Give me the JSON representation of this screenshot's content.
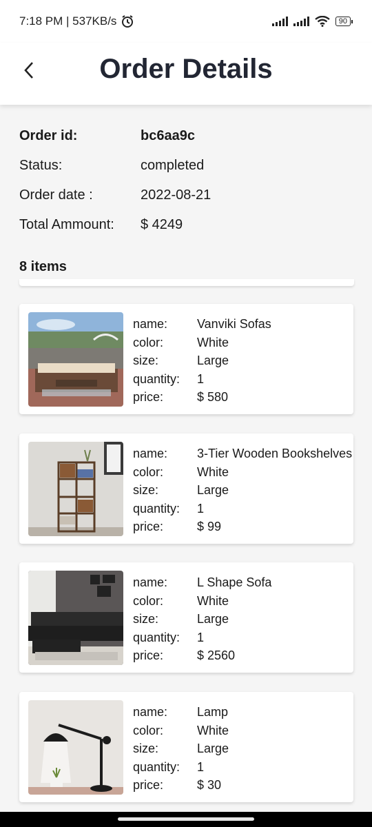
{
  "status_bar": {
    "time": "7:18 PM | 537KB/s",
    "battery": "90"
  },
  "app_bar": {
    "title": "Order Details"
  },
  "order": {
    "id_label": "Order id:",
    "id_value": "bc6aa9c",
    "status_label": "Status:",
    "status_value": "completed",
    "date_label": "Order date :",
    "date_value": "2022-08-21",
    "total_label": "Total Ammount:",
    "total_value": "$ 4249"
  },
  "items_count": "8 items",
  "field_labels": {
    "name": "name:",
    "color": "color:",
    "size": "size:",
    "quantity": "quantity:",
    "price": "price:"
  },
  "items": [
    {
      "name": "Vanviki Sofas",
      "color": "White",
      "size": "Large",
      "quantity": "1",
      "price": "$ 580",
      "image": "outdoor-sofa-set-photo"
    },
    {
      "name": "3-Tier Wooden Bookshelves",
      "color": "White",
      "size": "Large",
      "quantity": "1",
      "price": "$ 99",
      "image": "bookshelf-photo"
    },
    {
      "name": "L Shape Sofa",
      "color": "White",
      "size": "Large",
      "quantity": "1",
      "price": "$ 2560",
      "image": "l-shape-sofa-photo"
    },
    {
      "name": "Lamp",
      "color": "White",
      "size": "Large",
      "quantity": "1",
      "price": "$ 30",
      "image": "desk-lamp-photo"
    }
  ]
}
